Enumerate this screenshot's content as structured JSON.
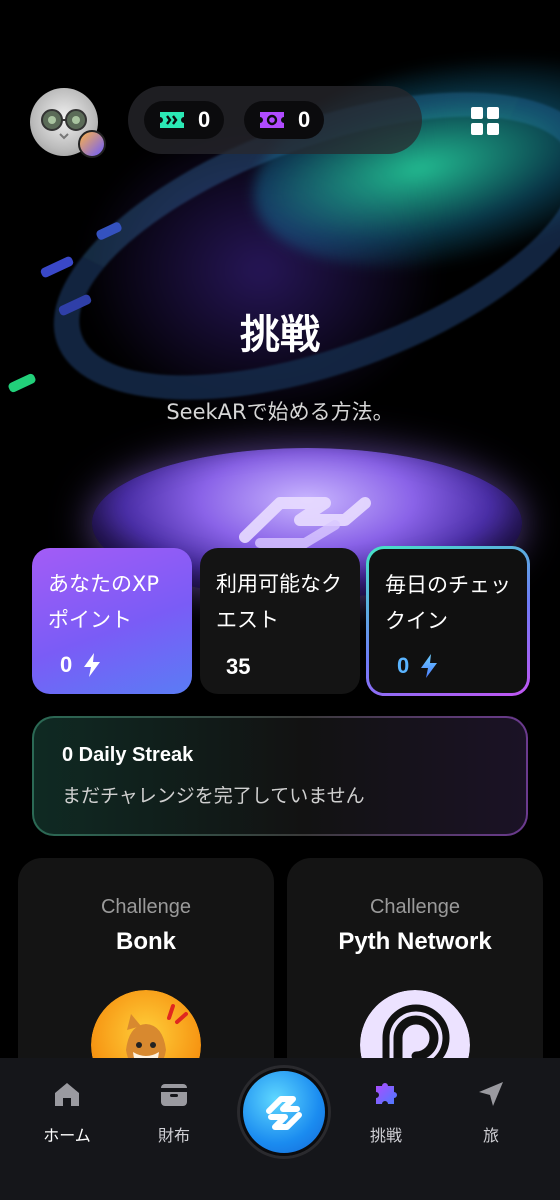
{
  "header": {
    "currencies": [
      {
        "icon": "green-ticket-icon",
        "value": "0",
        "color": "#2be8b5"
      },
      {
        "icon": "purple-ticket-icon",
        "value": "0",
        "color": "#b04bff"
      }
    ],
    "menu_icon": "grid-icon"
  },
  "hero": {
    "title": "挑戦",
    "subtitle": "SeekARで始める方法。"
  },
  "stats": [
    {
      "label": "あなたのXPポイント",
      "value": "0",
      "icon": "bolt-icon"
    },
    {
      "label": "利用可能なクエスト",
      "value": "35"
    },
    {
      "label": "毎日のチェックイン",
      "value": "0",
      "icon": "bolt-icon"
    }
  ],
  "streak": {
    "title": "0 Daily Streak",
    "subtitle": "まだチャレンジを完了していません"
  },
  "challenges": [
    {
      "kicker": "Challenge",
      "name": "Bonk",
      "logo": "bonk-logo"
    },
    {
      "kicker": "Challenge",
      "name": "Pyth Network",
      "logo": "pyth-logo"
    }
  ],
  "nav": {
    "items": [
      {
        "label": "ホーム",
        "icon": "home-icon",
        "active": true
      },
      {
        "label": "財布",
        "icon": "wallet-icon"
      },
      {
        "label": "",
        "icon": "seekar-logo-icon"
      },
      {
        "label": "挑戦",
        "icon": "puzzle-icon"
      },
      {
        "label": "旅",
        "icon": "navigation-arrow-icon"
      }
    ]
  },
  "colors": {
    "accent_purple": "#a35cf6",
    "accent_teal": "#45e6c4",
    "nav_bg": "#15161a"
  }
}
